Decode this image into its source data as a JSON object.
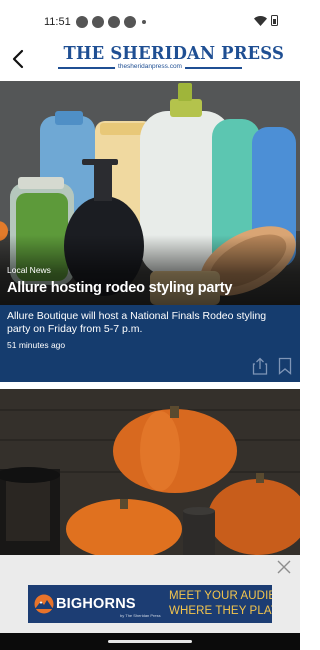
{
  "status_bar": {
    "time": "11:51",
    "icons": [
      "notification-dot-icon",
      "notification-dot-icon",
      "notification-dot-icon",
      "notification-dot-icon",
      "notification-small-dot-icon",
      "wifi-icon",
      "battery-icon"
    ]
  },
  "header": {
    "back_icon": "arrow-left-icon",
    "masthead_title": "THE SHERIDAN PRESS",
    "masthead_url": "thesheridanpress.com",
    "brand_color": "#1f4f93"
  },
  "stories": [
    {
      "category": "Local News",
      "headline": "Allure hosting rodeo styling party",
      "summary": "Allure Boutique will host a National Finals Rodeo styling party on Friday from 5-7 p.m.",
      "time_ago": "51 minutes ago",
      "actions": [
        "share-icon",
        "bookmark-icon"
      ],
      "summary_bg": "#153c6e"
    },
    {
      "image_subject": "pumpkins-and-candles"
    }
  ],
  "ad": {
    "close_icon": "close-icon",
    "brand": "BIGHORNS",
    "brand_sub": "by The Sheridan Press",
    "tagline_line1": "MEET YOUR AUDIENCE",
    "tagline_line2": "WHERE THEY PLAY",
    "bg_color": "#1c3d73",
    "tagline_color": "#f3c54d"
  }
}
